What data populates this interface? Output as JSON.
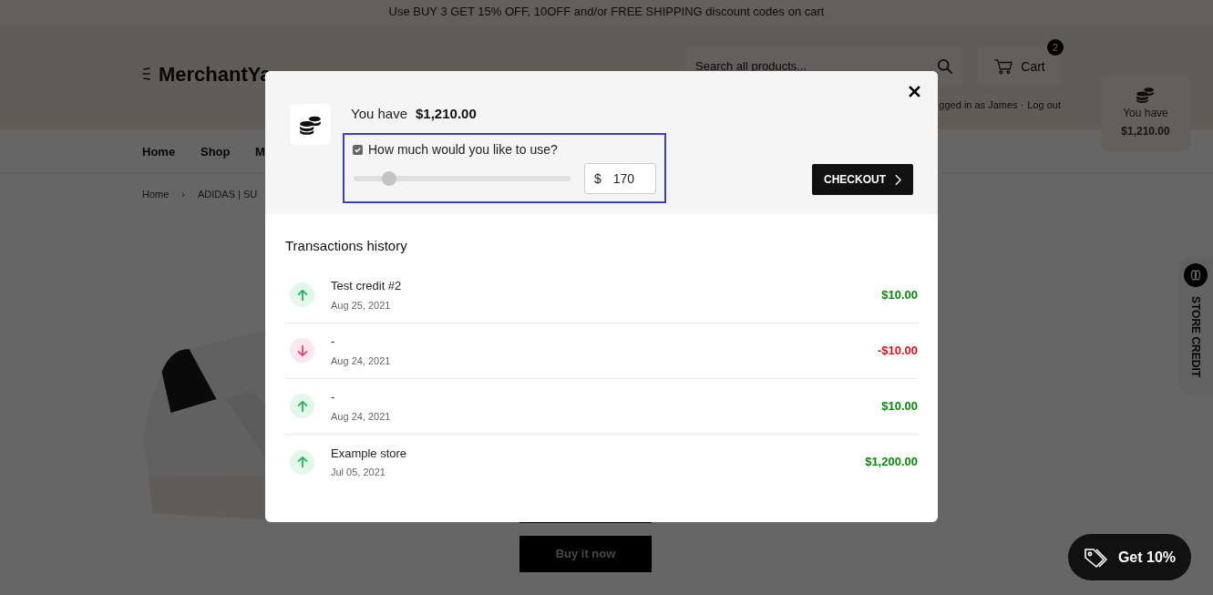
{
  "announcement": "Use BUY 3 GET 15% OFF, 10OFF and/or FREE SHIPPING discount codes on cart",
  "header": {
    "logo": "MerchantYa",
    "search": {
      "placeholder": "Search all products..."
    },
    "cart": {
      "label": "Cart",
      "count": "2"
    },
    "account": {
      "text": "gged in as James ·",
      "link": "Log out"
    }
  },
  "nav": [
    {
      "label": "Home"
    },
    {
      "label": "Shop"
    },
    {
      "label": "M"
    }
  ],
  "breadcrumb_separator": "›",
  "breadcrumb": [
    {
      "label": "Home"
    },
    {
      "label": "ADIDAS | SU"
    }
  ],
  "buttons": [
    {
      "label": "Buy it now"
    }
  ],
  "credit_widget": {
    "label": "You have",
    "amount": "$1,210.00"
  },
  "store_credit_tab": {
    "label": "STORE CREDIT"
  },
  "promo": {
    "label": "Get 10%"
  },
  "modal": {
    "balance_label": "You have",
    "balance": "$1,210.00",
    "use_label": "How much would you like to use?",
    "use_checked": true,
    "slider": {
      "level": 0.14
    },
    "amount": {
      "currency": "$",
      "value": "170"
    },
    "checkout": "CHECKOUT",
    "history_title": "Transactions history",
    "transactions": [
      {
        "kind": "credit",
        "title": "Test credit #2",
        "date": "Aug 25, 2021",
        "amount": "$10.00"
      },
      {
        "kind": "debit",
        "title": "-",
        "date": "Aug 24, 2021",
        "amount": "-$10.00"
      },
      {
        "kind": "credit",
        "title": "-",
        "date": "Aug 24, 2021",
        "amount": "$10.00"
      },
      {
        "kind": "credit",
        "title": "Example store",
        "date": "Jul 05, 2021",
        "amount": "$1,200.00"
      }
    ]
  }
}
